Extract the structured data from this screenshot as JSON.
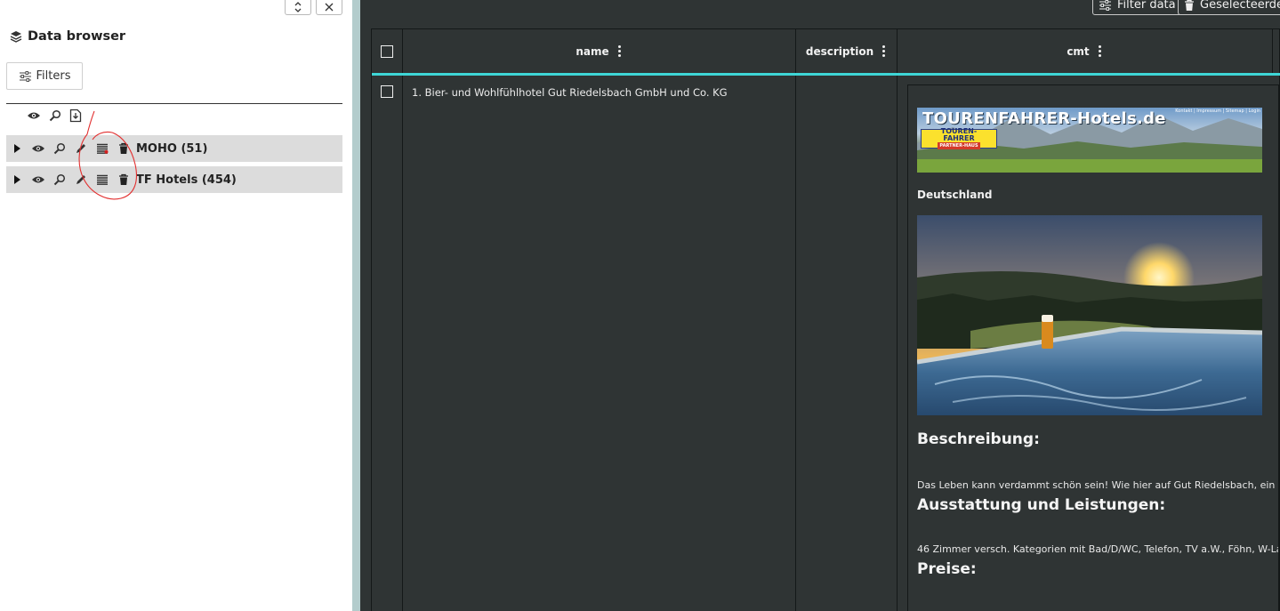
{
  "sidebar": {
    "title": "Data browser",
    "filters_label": "Filters",
    "layers": [
      {
        "label": "MOHO (51)"
      },
      {
        "label": "TF Hotels (454)"
      }
    ]
  },
  "toolbar": {
    "filter_data_label": "Filter data",
    "selected_label": "Geselecteerde"
  },
  "table": {
    "columns": [
      {
        "label": "name"
      },
      {
        "label": "description"
      },
      {
        "label": "cmt"
      }
    ],
    "rows": [
      {
        "name": "1. Bier- und Wohlfühlhotel Gut Riedelsbach GmbH und Co. KG",
        "description": "",
        "cmt": {
          "banner_title": "TOURENFAHRER-Hotels.de",
          "banner_nav": "Kontakt | Impressum | Sitemap | Login",
          "badge_line1": "TOUREN-",
          "badge_line2": "FAHRER",
          "badge_line3": "PARTNER-HAUS",
          "country": "Deutschland",
          "heading_description": "Beschreibung:",
          "text_description": "Das Leben kann verdammt schön sein! Wie hier auf Gut Riedelsbach, ein",
          "heading_equipment": "Ausstattung und Leistungen:",
          "text_equipment": "46 Zimmer versch. Kategorien mit Bad/D/WC, Telefon, TV a.W., Föhn, W-La",
          "heading_prices": "Preise:"
        }
      }
    ]
  },
  "colors": {
    "accent": "#3ed6d6",
    "table_bg": "#2f3434",
    "layer_row_bg": "#dcdcdc",
    "annotation": "#e23030"
  }
}
